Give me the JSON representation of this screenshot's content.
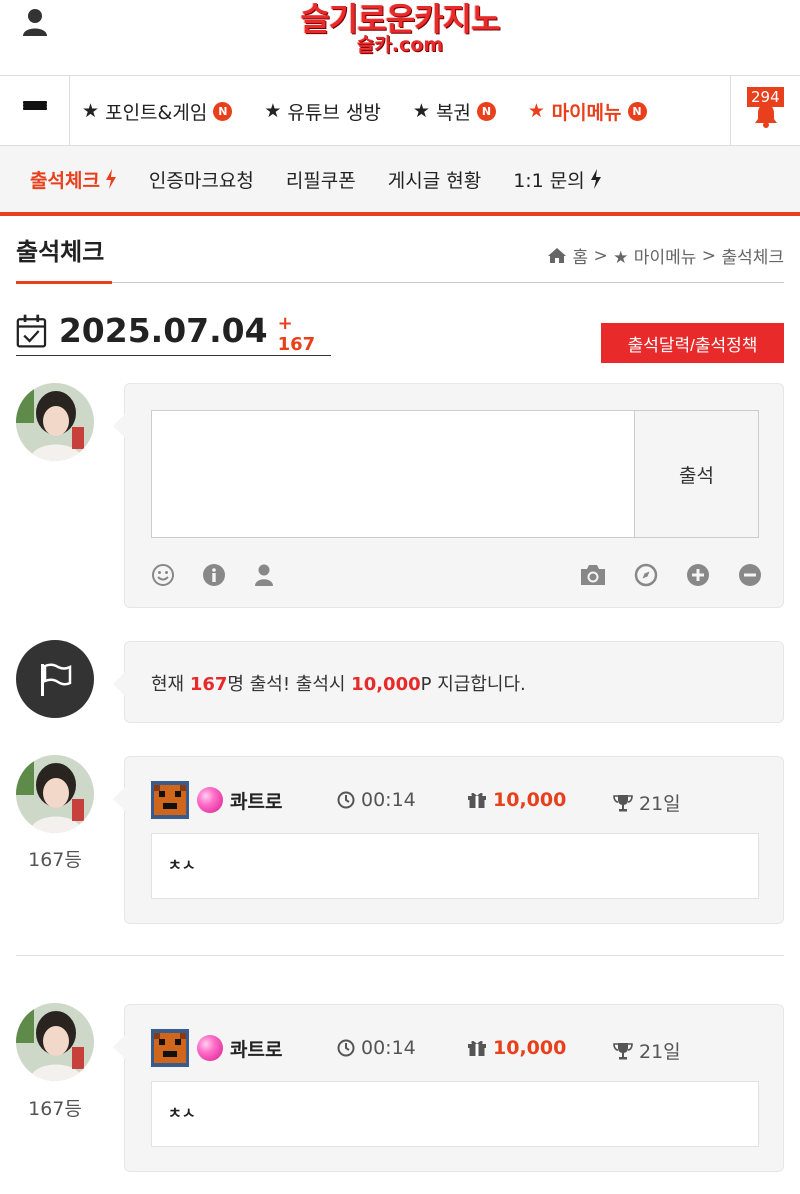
{
  "header": {
    "logo_main": "슬기로운카지노",
    "logo_sub": "슬카.com"
  },
  "nav": {
    "items": [
      {
        "label": "포인트&게임",
        "prefix": "★",
        "new_badge": "N"
      },
      {
        "label": "유튜브 생방",
        "prefix": "★",
        "new_badge": ""
      },
      {
        "label": "복권",
        "prefix": "★",
        "new_badge": "N"
      },
      {
        "label": "마이메뉴",
        "prefix": "★",
        "new_badge": "N"
      }
    ],
    "notification_count": "294"
  },
  "subnav": {
    "items": [
      {
        "label": "출석체크"
      },
      {
        "label": "인증마크요청"
      },
      {
        "label": "리필쿠폰"
      },
      {
        "label": "게시글 현황"
      },
      {
        "label": "1:1 문의"
      }
    ]
  },
  "page": {
    "title": "출석체크",
    "breadcrumb": {
      "home": "홈",
      "sep1": ">",
      "section": "★ 마이메뉴",
      "sep2": ">",
      "current": "출석체크"
    },
    "date": "2025.07.04",
    "date_count": "+ 167",
    "calendar_button": "출석달력/출석정책"
  },
  "write_box": {
    "submit_label": "출석",
    "placeholder": "",
    "tools_left": [
      "smile-icon",
      "info-icon",
      "user-icon"
    ],
    "tools_right": [
      "camera-icon",
      "compass-icon",
      "plus-circle-icon",
      "minus-circle-icon"
    ]
  },
  "info": {
    "prefix": "현재 ",
    "count": "167",
    "mid": "명 출석! 출석시 ",
    "points": "10,000",
    "suffix": "P 지급합니다."
  },
  "entries": [
    {
      "rank": "167등",
      "nickname": "콰트로",
      "time": "00:14",
      "points": "10,000",
      "days": "21일",
      "message": "ㅊㅅ"
    },
    {
      "rank": "167등",
      "nickname": "콰트로",
      "time": "00:14",
      "points": "10,000",
      "days": "21일",
      "message": "ㅊㅅ"
    }
  ],
  "colors": {
    "accent": "#e8401c",
    "brand_red": "#e82a2a",
    "panel_bg": "#f5f5f5"
  }
}
